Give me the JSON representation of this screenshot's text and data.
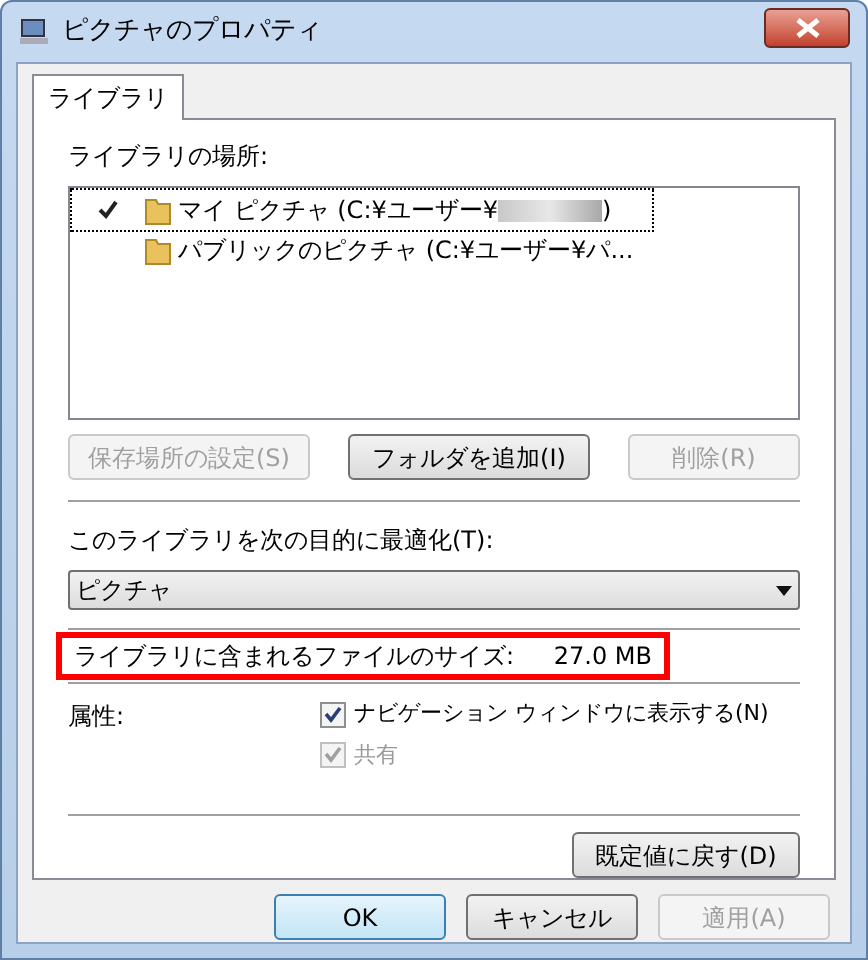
{
  "window": {
    "title": "ピクチャのプロパティ"
  },
  "tabs": [
    {
      "label": "ライブラリ",
      "selected": true
    }
  ],
  "locations": {
    "label": "ライブラリの場所:",
    "items": [
      {
        "name": "マイ ピクチャ (C:¥ユーザー¥",
        "suffix": ")",
        "redacted": true,
        "checked": true,
        "selected": true
      },
      {
        "name": "パブリックのピクチャ (C:¥ユーザー¥パ...",
        "checked": false,
        "selected": false
      }
    ]
  },
  "location_buttons": [
    {
      "label": "保存場所の設定(S)",
      "disabled": true
    },
    {
      "label": "フォルダを追加(I)",
      "disabled": false
    },
    {
      "label": "削除(R)",
      "disabled": true
    }
  ],
  "optimize": {
    "label": "このライブラリを次の目的に最適化(T):",
    "value": "ピクチャ"
  },
  "size": {
    "label": "ライブラリに含まれるファイルのサイズ:",
    "value": "27.0 MB",
    "highlighted": true
  },
  "attributes": {
    "label": "属性:",
    "options": [
      {
        "label": "ナビゲーション ウィンドウに表示する(N)",
        "checked": true,
        "disabled": false
      },
      {
        "label": "共有",
        "checked": true,
        "disabled": true
      }
    ]
  },
  "restore_button": {
    "label": "既定値に戻す(D)"
  },
  "dialog_buttons": [
    {
      "label": "OK",
      "default": true,
      "disabled": false
    },
    {
      "label": "キャンセル",
      "default": false,
      "disabled": false
    },
    {
      "label": "適用(A)",
      "default": false,
      "disabled": true
    }
  ]
}
